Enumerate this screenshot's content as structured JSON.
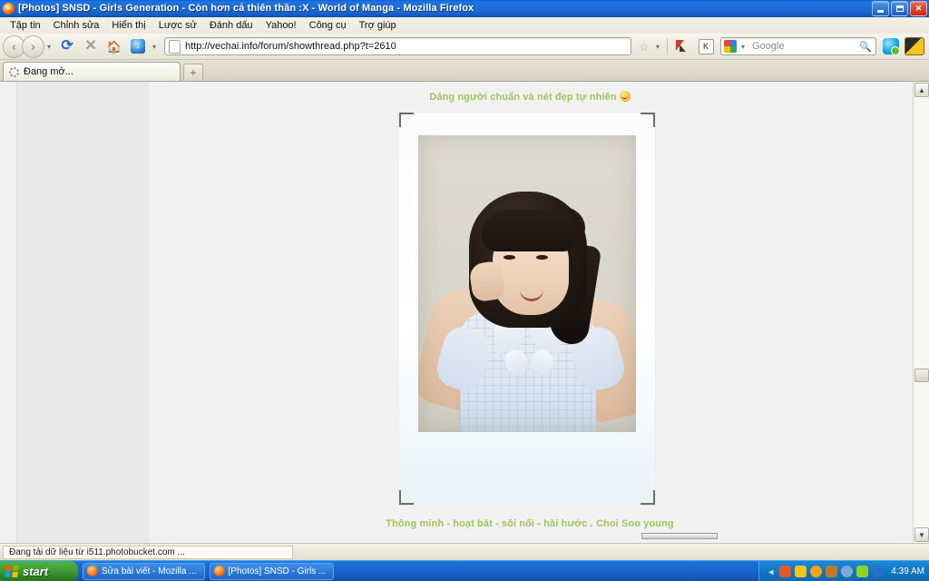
{
  "window": {
    "title": "[Photos] SNSD - Girls Generation - Còn hơn cả thiên thần :X - World of Manga - Mozilla Firefox",
    "app_icon": "firefox-icon",
    "controls": {
      "minimize": "minimize-button",
      "maximize": "restore-button",
      "close": "close-button",
      "close_glyph": "✕"
    }
  },
  "menu": {
    "items": [
      {
        "label": "Tập tin"
      },
      {
        "label": "Chỉnh sửa"
      },
      {
        "label": "Hiển thị"
      },
      {
        "label": "Lược sử"
      },
      {
        "label": "Đánh dấu"
      },
      {
        "label": "Yahoo!"
      },
      {
        "label": "Công cụ"
      },
      {
        "label": "Trợ giúp"
      }
    ]
  },
  "toolbar": {
    "back_glyph": "‹",
    "forward_glyph": "›",
    "history_caret": "▾",
    "reload_glyph": "⟳",
    "stop_glyph": "✕",
    "home_glyph": "🏠",
    "download_glyph": "↓",
    "bookmark_caret": "▾",
    "url": "http://vechai.info/forum/showthread.php?t=2610",
    "star_glyph": "☆",
    "star_caret": "▾",
    "k_label": "K",
    "search_engine": "Google",
    "search_caret": "▾",
    "search_glyph": "🔍",
    "search_value": ""
  },
  "tabs": {
    "active": {
      "label": "Đang mở...",
      "icon": "loading-spinner-icon"
    },
    "new_tab_glyph": "+"
  },
  "page": {
    "caption_top": "Dáng người chuẩn và nét đẹp tự nhiên",
    "caption_top_emoticon": "smiley-emoticon",
    "caption_bottom": "Thông minh - hoạt bát - sôi nổi - hài hước . Choi Soo young",
    "caption_color": "#9fc65a",
    "photo_alt": "polaroid-photo-of-woman"
  },
  "scrollbar": {
    "up_glyph": "▲",
    "down_glyph": "▼"
  },
  "status": {
    "text": "Đang tải dữ liệu từ i511.photobucket.com ..."
  },
  "taskbar": {
    "start_label": "start",
    "windows": [
      {
        "label": "Sửa bài viết - Mozilla ...",
        "icon": "firefox-icon"
      },
      {
        "label": "[Photos] SNSD - Girls ...",
        "icon": "firefox-icon"
      }
    ],
    "tray": {
      "chevron": "◄",
      "icons": [
        {
          "name": "messenger-icon",
          "color": "#e25822"
        },
        {
          "name": "yahoo-icon",
          "color": "#f3c51b"
        },
        {
          "name": "smiley-icon",
          "color": "#f0a31b"
        },
        {
          "name": "download-manager-icon",
          "color": "#c07a2a"
        },
        {
          "name": "clock-tool-icon",
          "color": "#7fa8d8"
        },
        {
          "name": "antivirus-icon",
          "color": "#8fd32a"
        },
        {
          "name": "update-icon",
          "color": "#2a6fc9"
        }
      ],
      "clock": "4:39 AM"
    }
  }
}
